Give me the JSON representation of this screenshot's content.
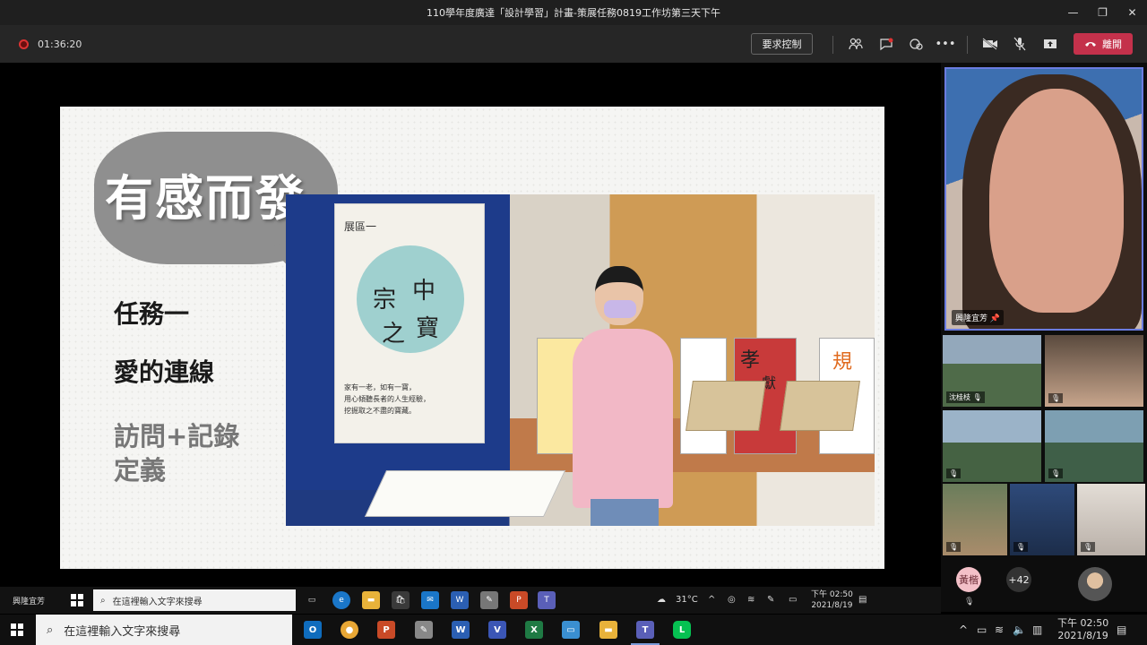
{
  "window": {
    "title": "110學年度廣達「設計學習」計畫-策展任務0819工作坊第三天下午",
    "controls": [
      "—",
      "❐",
      "✕"
    ]
  },
  "toolbar": {
    "timer": "01:36:20",
    "request_control": "要求控制",
    "leave": "離開",
    "icons": [
      "people-icon",
      "chat-icon",
      "reactions-icon",
      "more-icon",
      "camera-off-icon",
      "mic-off-icon",
      "share-icon"
    ]
  },
  "slide": {
    "title": "有感而發",
    "task1": "任務一",
    "task2": "愛的連線",
    "task3_line1": "訪問+記錄",
    "task3_line2": "定義",
    "photo": {
      "poster_head": "展區一",
      "poster_chars": [
        "宗",
        "中",
        "之",
        "寶"
      ],
      "poster_lines": [
        "家有一老，如有一寶，",
        "用心傾聽長者的人生經驗，",
        "挖掘取之不盡的寶藏。"
      ],
      "card_chars": [
        "孝",
        "獻",
        "規"
      ]
    }
  },
  "participants": {
    "pinned_name": "興隆宜芳",
    "tile1_name": "沈桂枝",
    "overflow_initials": "黃楷",
    "overflow_count": "+42"
  },
  "inner_taskbar": {
    "user": "興隆宜芳",
    "search_placeholder": "在這裡輸入文字來搜尋",
    "weather": "31°C",
    "time": "下午 02:50",
    "date": "2021/8/19"
  },
  "taskbar": {
    "search_placeholder": "在這裡輸入文字來搜尋",
    "time": "下午 02:50",
    "date": "2021/8/19"
  },
  "colors": {
    "leave_red": "#c4314b",
    "toolbar_bg": "#262626",
    "active_frame": "#6b7ce0"
  }
}
